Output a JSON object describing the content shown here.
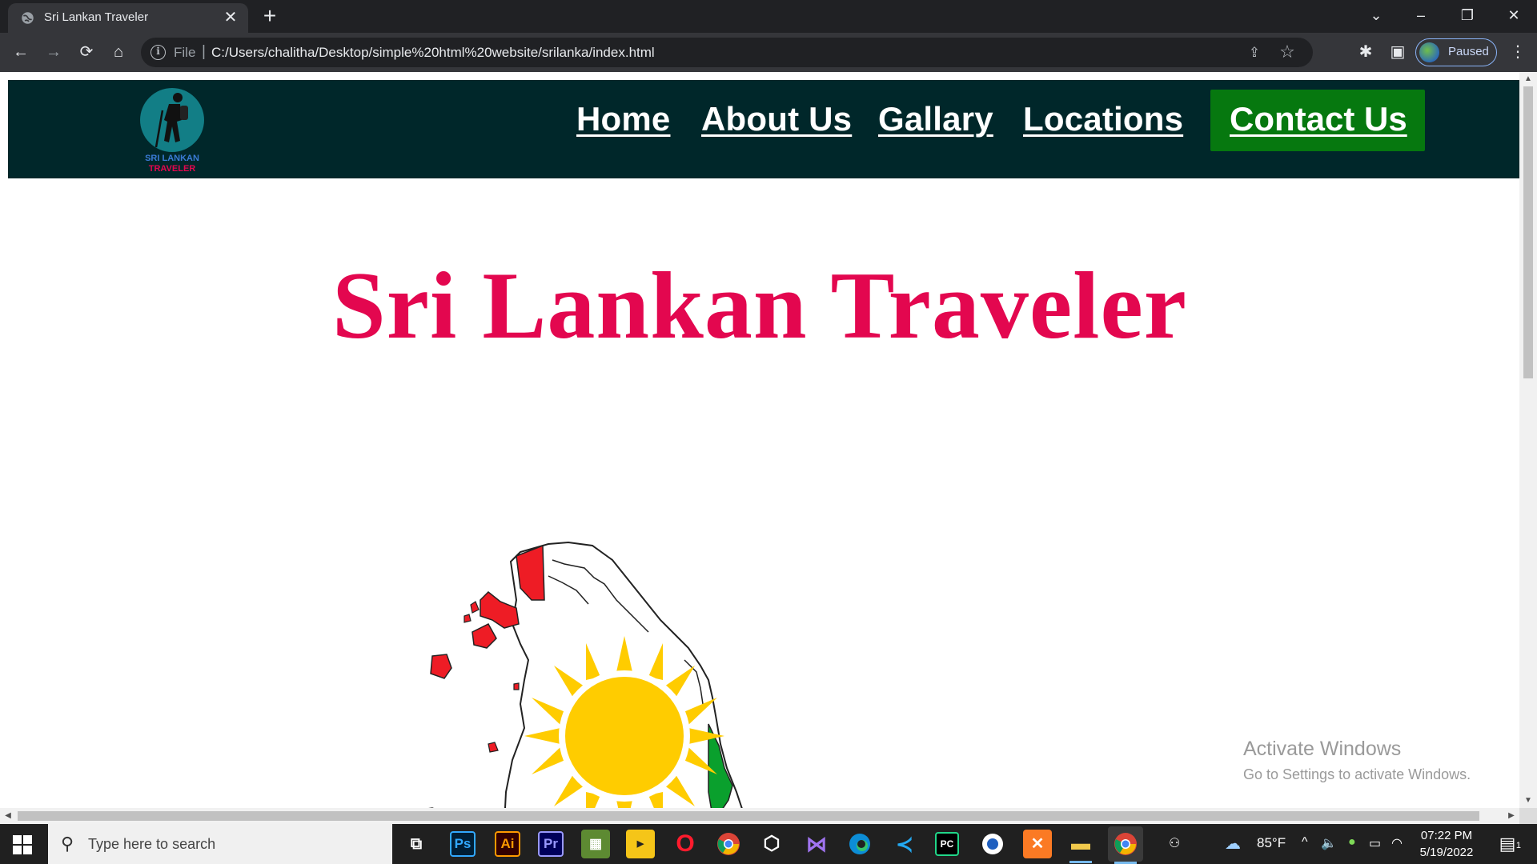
{
  "browser": {
    "tab_title": "Sri Lankan Traveler",
    "tab_close": "✕",
    "new_tab": "+",
    "scheme_label": "File",
    "url": "C:/Users/chalitha/Desktop/simple%20html%20website/srilanka/index.html",
    "profile_status": "Paused"
  },
  "site": {
    "logo_text_top": "SRI LANKAN",
    "logo_text_bottom": "TRAVELER",
    "nav": {
      "home": "Home",
      "about": "About Us",
      "gallery": "Gallary",
      "locations": "Locations",
      "contact": "Contact Us"
    },
    "hero_title": "Sri Lankan Traveler",
    "colors": {
      "nav_bg": "#00272a",
      "contact_bg": "#06780f",
      "title": "#e3074f"
    }
  },
  "watermark": {
    "line1": "Activate Windows",
    "line2": "Go to Settings to activate Windows."
  },
  "taskbar": {
    "search_placeholder": "Type here to search",
    "apps": [
      "task-view",
      "photoshop",
      "illustrator",
      "premiere",
      "minecraft",
      "player",
      "opera",
      "chrome",
      "virtualbox",
      "visual-studio",
      "edge",
      "vscode",
      "pycharm",
      "app",
      "xampp",
      "file-explorer",
      "chrome-active"
    ],
    "ps": "Ps",
    "ai": "Ai",
    "pr": "Pr",
    "pc": "PC",
    "temperature": "85°F",
    "time": "07:22 PM",
    "date": "5/19/2022",
    "notif_count": "1"
  }
}
